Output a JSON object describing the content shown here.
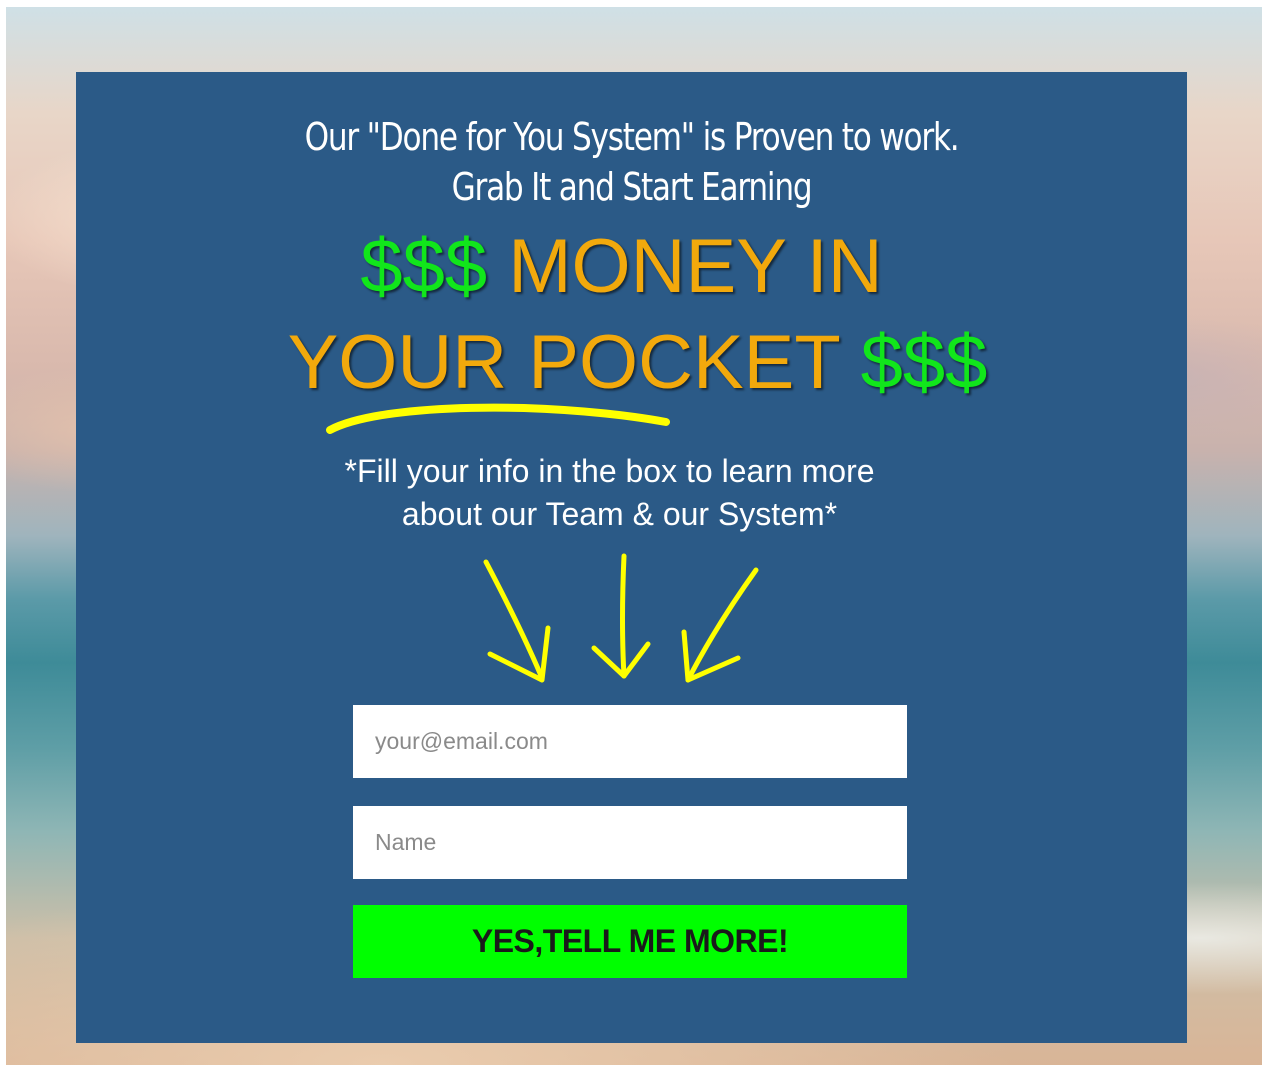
{
  "headline": {
    "line1": "Our \"Done for You System\" is Proven to work.",
    "line2": "Grab It and Start Earning"
  },
  "hero": {
    "line1_dollars": "$$$",
    "line1_text": "MONEY IN",
    "line2_text": "YOUR POCKET",
    "line2_dollars": "$$$"
  },
  "info": {
    "line1": "*Fill your info in the box to learn more",
    "line2": "about our Team & our System*"
  },
  "form": {
    "email_placeholder": "your@email.com",
    "email_value": "",
    "name_placeholder": "Name",
    "name_value": "",
    "submit_label": "YES,TELL ME MORE!"
  },
  "decorations": {
    "underline_icon": "yellow-swoosh-underline-icon",
    "arrows_icon": "three-down-arrows-icon"
  },
  "colors": {
    "panel": "#2b5a87",
    "dollars": "#11e61b",
    "gold": "#f2a90c",
    "accent_yellow": "#ffff00",
    "submit": "#00ff00"
  }
}
